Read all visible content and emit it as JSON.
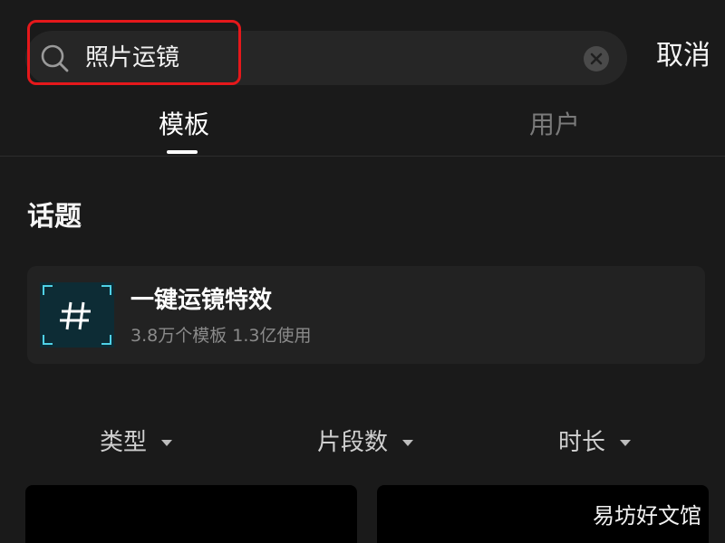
{
  "search": {
    "query": "照片运镜"
  },
  "header": {
    "cancel_label": "取消"
  },
  "tabs": [
    {
      "label": "模板",
      "active": true
    },
    {
      "label": "用户",
      "active": false
    }
  ],
  "topics": {
    "section_title": "话题",
    "items": [
      {
        "name": "一键运镜特效",
        "meta": "3.8万个模板 1.3亿使用",
        "thumb_text": "一键运镜特效"
      }
    ]
  },
  "filters": [
    {
      "label": "类型"
    },
    {
      "label": "片段数"
    },
    {
      "label": "时长"
    }
  ],
  "watermark": "易坊好文馆",
  "colors": {
    "background": "#1a1a1a",
    "highlight": "#e5181b",
    "inactive_text": "#7a7a7a",
    "secondary_text": "#8a8a8a"
  },
  "icons": {
    "search": "search-icon",
    "clear": "close-icon",
    "dropdown": "caret-down-icon",
    "topic": "hashtag-icon"
  }
}
